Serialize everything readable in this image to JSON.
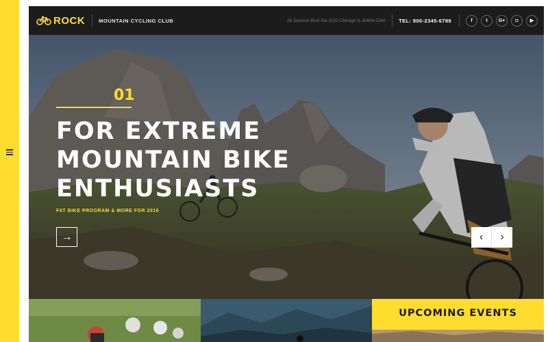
{
  "header": {
    "logo_text": "ROCK",
    "club_name": "MOUNTAIN CYCLING CLUB",
    "address": "28 Jackson Blvd Ste 1020 Chicago IL 60604-2340",
    "phone": "TEL: 800-2345-6789",
    "socials": [
      {
        "name": "facebook-icon",
        "glyph": "f"
      },
      {
        "name": "twitter-icon",
        "glyph": "t"
      },
      {
        "name": "google-plus-icon",
        "glyph": "G+"
      },
      {
        "name": "instagram-icon",
        "glyph": "◘"
      },
      {
        "name": "youtube-icon",
        "glyph": "▶"
      }
    ]
  },
  "hero": {
    "slide_number": "01",
    "title_lines": [
      "FOR EXTREME",
      "MOUNTAIN BIKE",
      "ENTHUSIASTS"
    ],
    "subtitle": "FAT BIKE PROGRAM & MORE FOR 2016",
    "next_glyph": "→",
    "prev_glyph": "‹",
    "fwd_glyph": "›"
  },
  "events": {
    "title": "UPCOMING EVENTS"
  },
  "colors": {
    "accent": "#ffdd2e",
    "header_bg": "#1c1c1c"
  }
}
